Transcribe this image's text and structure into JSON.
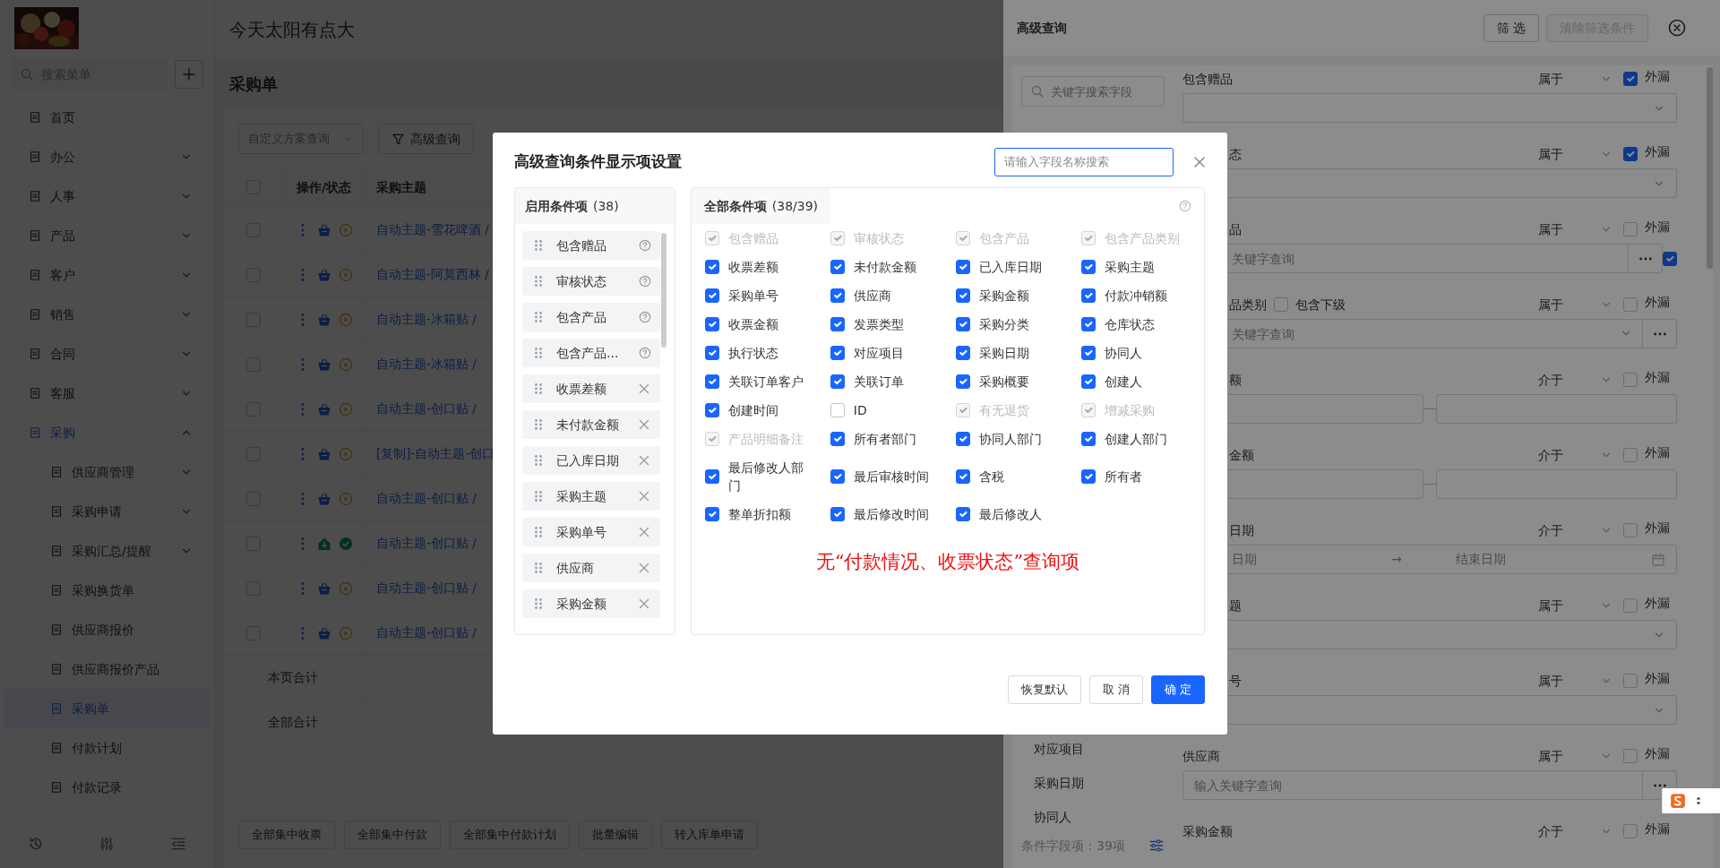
{
  "app": {
    "title": "今天太阳有点大",
    "search_placeholder": "搜索菜单",
    "menu": [
      {
        "label": "首页",
        "kind": "link",
        "selected": false
      },
      {
        "label": "办公",
        "kind": "group",
        "expanded": false,
        "selected": false
      },
      {
        "label": "人事",
        "kind": "group",
        "expanded": false,
        "selected": false
      },
      {
        "label": "产品",
        "kind": "group",
        "expanded": false,
        "selected": false
      },
      {
        "label": "客户",
        "kind": "group",
        "expanded": false,
        "selected": false
      },
      {
        "label": "销售",
        "kind": "group",
        "expanded": false,
        "selected": false
      },
      {
        "label": "合同",
        "kind": "group",
        "expanded": false,
        "selected": false
      },
      {
        "label": "客服",
        "kind": "group",
        "expanded": false,
        "selected": false
      },
      {
        "label": "采购",
        "kind": "group",
        "expanded": true,
        "selected": true,
        "children": [
          {
            "label": "供应商管理",
            "kind": "group",
            "expanded": false,
            "selected": false
          },
          {
            "label": "采购申请",
            "kind": "group",
            "expanded": false,
            "selected": false
          },
          {
            "label": "采购汇总/提醒",
            "kind": "group",
            "expanded": false,
            "selected": false
          },
          {
            "label": "采购换货单",
            "kind": "link",
            "selected": false
          },
          {
            "label": "供应商报价",
            "kind": "link",
            "selected": false
          },
          {
            "label": "供应商报价产品",
            "kind": "link",
            "selected": false
          },
          {
            "label": "采购单",
            "kind": "link",
            "selected": true
          },
          {
            "label": "付款计划",
            "kind": "link",
            "selected": false
          },
          {
            "label": "付款记录",
            "kind": "link",
            "selected": false
          }
        ]
      }
    ],
    "page": {
      "title": "采购单",
      "scheme_placeholder": "自定义方案查询",
      "advanced_button": "高级查询",
      "select_all_checked": false,
      "columns": [
        "操作/状态",
        "采购主题"
      ],
      "rows": [
        {
          "subject": "自动主题-雪花啤酒 /",
          "kind": "pending",
          "checked": false
        },
        {
          "subject": "自动主题-阿莫西林 /",
          "kind": "pending",
          "checked": false
        },
        {
          "subject": "自动主题-冰箱贴 /",
          "kind": "pending",
          "checked": false
        },
        {
          "subject": "自动主题-冰箱贴 /",
          "kind": "pending",
          "checked": false
        },
        {
          "subject": "自动主题-创口贴 /",
          "kind": "pending",
          "checked": false
        },
        {
          "subject": "[复制]-自动主题-创口",
          "kind": "pending",
          "checked": false
        },
        {
          "subject": "自动主题-创口贴 /",
          "kind": "pending",
          "checked": false
        },
        {
          "subject": "自动主题-创口贴 /",
          "kind": "done",
          "checked": false
        },
        {
          "subject": "自动主题-创口贴 /",
          "kind": "pending",
          "checked": false
        },
        {
          "subject": "自动主题-创口贴 /",
          "kind": "pending",
          "checked": false
        }
      ],
      "summary": [
        "本页合计",
        "全部合计"
      ],
      "actions": [
        "全部集中收票",
        "全部集中付款",
        "全部集中付款计划",
        "批量编辑",
        "转入库单申请"
      ]
    }
  },
  "drawer": {
    "title": "高级查询",
    "filter_button": "筛 选",
    "clear_button": "清除筛选条件",
    "clear_disabled": true,
    "search_placeholder": "关键字搜索字段",
    "field_list": [
      "对应项目",
      "采购日期",
      "协同人"
    ],
    "footer": "条件字段项：39项",
    "conditions": [
      {
        "label": "包含赠品",
        "operator": "属于",
        "leak": true,
        "leak_label": "外漏",
        "kind": "select"
      },
      {
        "label": "态",
        "cut": true,
        "operator": "属于",
        "leak": true,
        "leak_label": "外漏",
        "kind": "select"
      },
      {
        "label": "品",
        "cut": true,
        "operator": "属于",
        "leak": false,
        "leak_label": "外漏",
        "kind": "lookup",
        "placeholder": "关键字查询",
        "extra_checked": true
      },
      {
        "label": "品类别",
        "cut": true,
        "sub_option": {
          "label": "包含下级",
          "checked": false
        },
        "operator": "属于",
        "leak": false,
        "leak_label": "外漏",
        "kind": "lookup_select",
        "placeholder": "关键字查询"
      },
      {
        "label": "额",
        "cut": true,
        "operator": "介于",
        "leak": false,
        "leak_label": "外漏",
        "kind": "range"
      },
      {
        "label": "金额",
        "cut": true,
        "operator": "介于",
        "leak": false,
        "leak_label": "外漏",
        "kind": "range"
      },
      {
        "label": "日期",
        "cut": true,
        "operator": "介于",
        "leak": false,
        "leak_label": "外漏",
        "kind": "date_range",
        "start_placeholder": "日期",
        "separator": "→",
        "end_placeholder": "结束日期"
      },
      {
        "label": "题",
        "cut": true,
        "operator": "属于",
        "leak": false,
        "leak_label": "外漏",
        "kind": "select"
      },
      {
        "label": "号",
        "cut": true,
        "operator": "属于",
        "leak": false,
        "leak_label": "外漏",
        "kind": "select"
      },
      {
        "label": "供应商",
        "operator": "属于",
        "leak": false,
        "leak_label": "外漏",
        "kind": "lookup",
        "placeholder": "输入关键字查询"
      },
      {
        "label": "采购金额",
        "operator": "介于",
        "leak": false,
        "leak_label": "外漏",
        "kind": "none"
      }
    ]
  },
  "modal": {
    "title": "高级查询条件显示项设置",
    "search_placeholder": "请输入字段名称搜索",
    "enabled": {
      "title": "启用条件项",
      "count": "(38)",
      "items": [
        {
          "label": "包含赠品",
          "locked": true
        },
        {
          "label": "审核状态",
          "locked": true
        },
        {
          "label": "包含产品",
          "locked": true
        },
        {
          "label": "包含产品...",
          "locked": true
        },
        {
          "label": "收票差额",
          "locked": false
        },
        {
          "label": "未付款金额",
          "locked": false
        },
        {
          "label": "已入库日期",
          "locked": false
        },
        {
          "label": "采购主题",
          "locked": false
        },
        {
          "label": "采购单号",
          "locked": false
        },
        {
          "label": "供应商",
          "locked": false
        },
        {
          "label": "采购金额",
          "locked": false
        }
      ]
    },
    "all": {
      "title": "全部条件项",
      "count": "(38/39)",
      "items": [
        {
          "label": "包含赠品",
          "checked": true,
          "disabled": true
        },
        {
          "label": "审核状态",
          "checked": true,
          "disabled": true
        },
        {
          "label": "包含产品",
          "checked": true,
          "disabled": true
        },
        {
          "label": "包含产品类别",
          "checked": true,
          "disabled": true
        },
        {
          "label": "收票差额",
          "checked": true,
          "disabled": false
        },
        {
          "label": "未付款金额",
          "checked": true,
          "disabled": false
        },
        {
          "label": "已入库日期",
          "checked": true,
          "disabled": false
        },
        {
          "label": "采购主题",
          "checked": true,
          "disabled": false
        },
        {
          "label": "采购单号",
          "checked": true,
          "disabled": false
        },
        {
          "label": "供应商",
          "checked": true,
          "disabled": false
        },
        {
          "label": "采购金额",
          "checked": true,
          "disabled": false
        },
        {
          "label": "付款冲销额",
          "checked": true,
          "disabled": false
        },
        {
          "label": "收票金额",
          "checked": true,
          "disabled": false
        },
        {
          "label": "发票类型",
          "checked": true,
          "disabled": false
        },
        {
          "label": "采购分类",
          "checked": true,
          "disabled": false
        },
        {
          "label": "仓库状态",
          "checked": true,
          "disabled": false
        },
        {
          "label": "执行状态",
          "checked": true,
          "disabled": false
        },
        {
          "label": "对应项目",
          "checked": true,
          "disabled": false
        },
        {
          "label": "采购日期",
          "checked": true,
          "disabled": false
        },
        {
          "label": "协同人",
          "checked": true,
          "disabled": false
        },
        {
          "label": "关联订单客户",
          "checked": true,
          "disabled": false
        },
        {
          "label": "关联订单",
          "checked": true,
          "disabled": false
        },
        {
          "label": "采购概要",
          "checked": true,
          "disabled": false
        },
        {
          "label": "创建人",
          "checked": true,
          "disabled": false
        },
        {
          "label": "创建时间",
          "checked": true,
          "disabled": false
        },
        {
          "label": "ID",
          "checked": false,
          "disabled": false
        },
        {
          "label": "有无退货",
          "checked": true,
          "disabled": true
        },
        {
          "label": "增减采购",
          "checked": true,
          "disabled": true
        },
        {
          "label": "产品明细备注",
          "checked": true,
          "disabled": true
        },
        {
          "label": "所有者部门",
          "checked": true,
          "disabled": false
        },
        {
          "label": "协同人部门",
          "checked": true,
          "disabled": false
        },
        {
          "label": "创建人部门",
          "checked": true,
          "disabled": false
        },
        {
          "label": "最后修改人部门",
          "checked": true,
          "disabled": false
        },
        {
          "label": "最后审核时间",
          "checked": true,
          "disabled": false
        },
        {
          "label": "含税",
          "checked": true,
          "disabled": false
        },
        {
          "label": "所有者",
          "checked": true,
          "disabled": false
        },
        {
          "label": "整单折扣额",
          "checked": true,
          "disabled": false
        },
        {
          "label": "最后修改时间",
          "checked": true,
          "disabled": false
        },
        {
          "label": "最后修改人",
          "checked": true,
          "disabled": false
        }
      ]
    },
    "note": "无“付款情况、收票状态”查询项",
    "buttons": [
      {
        "label": "恢复默认",
        "kind": "default"
      },
      {
        "label": "取 消",
        "kind": "default"
      },
      {
        "label": "确 定",
        "kind": "primary"
      }
    ]
  }
}
